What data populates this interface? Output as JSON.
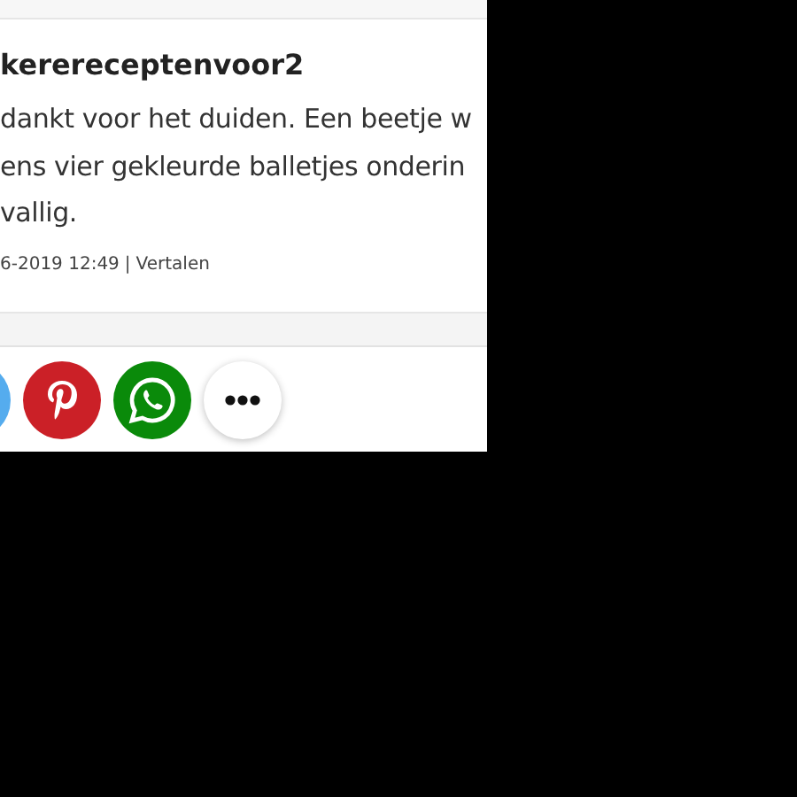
{
  "comment": {
    "author": "kerereceptenvoor2",
    "body": [
      "dankt voor het duiden. Een beetje w",
      "ens vier gekleurde balletjes onderin",
      "vallig."
    ],
    "date": "6-2019 12:49",
    "separator": "|",
    "translate_link": "Vertalen"
  },
  "share_buttons": [
    {
      "kind": "twitter",
      "color": "#55acee"
    },
    {
      "kind": "pinterest",
      "color": "#cb2027"
    },
    {
      "kind": "whatsapp",
      "color": "#0a8a0a"
    },
    {
      "kind": "more",
      "color": "#ffffff"
    }
  ]
}
